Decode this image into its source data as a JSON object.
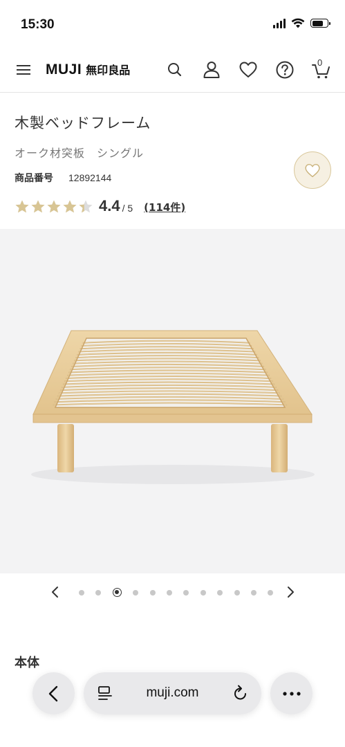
{
  "status_bar": {
    "time": "15:30"
  },
  "header": {
    "logo_en": "MUJI",
    "logo_jp": "無印良品",
    "cart_count": "0",
    "icons": [
      "menu-icon",
      "search-icon",
      "account-icon",
      "favorite-icon",
      "help-icon",
      "cart-icon"
    ]
  },
  "product": {
    "title": "木製ベッドフレーム",
    "variant": "オーク材突板　シングル",
    "code_label": "商品番号",
    "code_value": "12892144",
    "rating": 4.4,
    "rating_value": "4.4",
    "rating_max": "/ 5",
    "review_count": "(114件)"
  },
  "carousel": {
    "total": 12,
    "active_index": 2
  },
  "section": {
    "heading": "本体"
  },
  "browser": {
    "url": "muji.com"
  },
  "colors": {
    "star_filled": "#d8c594",
    "star_empty": "#dddddd",
    "favorite_bg": "#f6f0e2",
    "favorite_border": "#d9c79a",
    "image_bg": "#f3f3f4"
  }
}
